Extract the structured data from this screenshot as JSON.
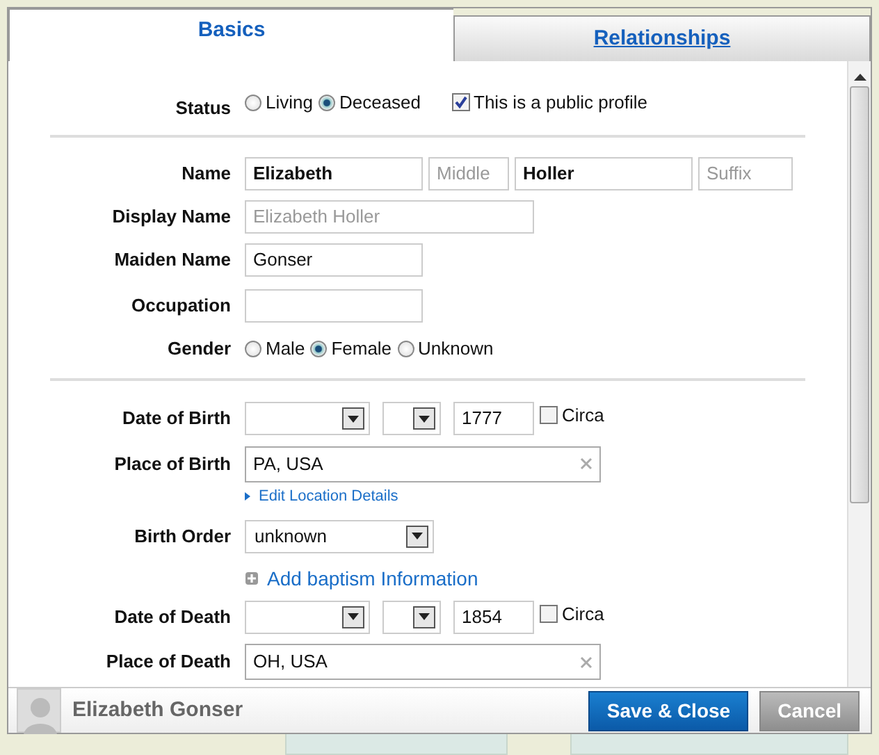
{
  "tabs": [
    {
      "label": "Basics",
      "selected": true
    },
    {
      "label": "Relationships",
      "selected": false
    }
  ],
  "status": {
    "label": "Status",
    "options": [
      {
        "label": "Living",
        "selected": false
      },
      {
        "label": "Deceased",
        "selected": true
      }
    ],
    "public_profile": {
      "label": "This is a public profile",
      "checked": true
    }
  },
  "name": {
    "label": "Name",
    "fields": [
      {
        "value": "Elizabeth"
      },
      {
        "placeholder": "Middle"
      },
      {
        "value": "Holler"
      },
      {
        "placeholder": "Suffix"
      }
    ]
  },
  "display_name": {
    "label": "Display Name",
    "placeholder": "Elizabeth Holler"
  },
  "maiden_name": {
    "label": "Maiden Name",
    "value": "Gonser"
  },
  "occupation": {
    "label": "Occupation"
  },
  "gender": {
    "label": "Gender",
    "options": [
      {
        "label": "Male",
        "selected": false
      },
      {
        "label": "Female",
        "selected": true
      },
      {
        "label": "Unknown",
        "selected": false
      }
    ]
  },
  "date_of_birth": {
    "label": "Date of Birth",
    "year": "1777",
    "circa": {
      "label": "Circa",
      "checked": false
    }
  },
  "place_of_birth": {
    "label": "Place of Birth",
    "value": "PA, USA",
    "link": "Edit Location Details"
  },
  "birth_order": {
    "label": "Birth Order",
    "value": "unknown"
  },
  "baptism_link": "Add baptism Information",
  "date_of_death": {
    "label": "Date of Death",
    "year": "1854",
    "circa": {
      "label": "Circa",
      "checked": false
    }
  },
  "place_of_death": {
    "label": "Place of Death",
    "value": "OH, USA"
  },
  "footer": {
    "person_name": "Elizabeth Gonser",
    "buttons": [
      {
        "label": "Save & Close",
        "kind": "primary"
      },
      {
        "label": "Cancel",
        "kind": "secondary"
      }
    ]
  }
}
